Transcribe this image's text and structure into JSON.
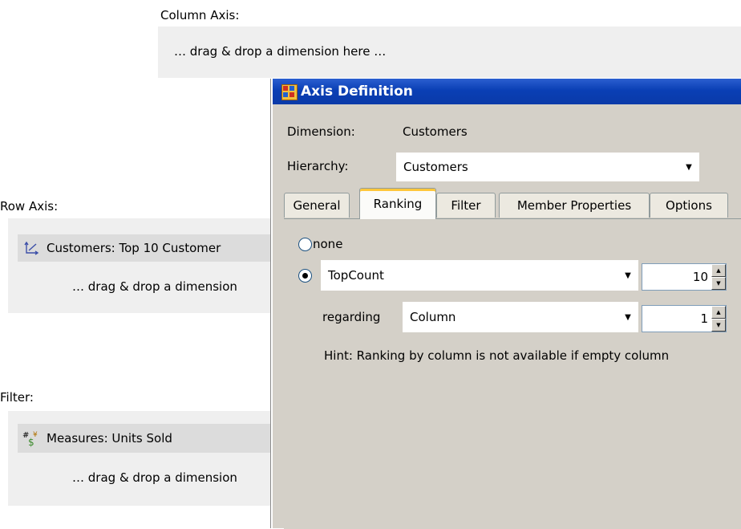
{
  "column_axis": {
    "label": "Column Axis:",
    "drop_hint": "… drag & drop a dimension here …"
  },
  "row_axis": {
    "label": "Row Axis:",
    "member": "Customers: Top 10 Customer",
    "member_icon": "axis-icon",
    "drop_hint": "… drag & drop a dimension"
  },
  "filter": {
    "label": "Filter:",
    "member": "Measures: Units Sold",
    "member_icon": "measures-icon",
    "drop_hint": "… drag & drop a dimension"
  },
  "dialog": {
    "title": "Axis Definition",
    "dimension_label": "Dimension:",
    "dimension_value": "Customers",
    "hierarchy_label": "Hierarchy:",
    "hierarchy_value": "Customers",
    "tabs": [
      {
        "label": "General",
        "active": false
      },
      {
        "label": "Ranking",
        "active": true
      },
      {
        "label": "Filter",
        "active": false
      },
      {
        "label": "Member Properties",
        "active": false
      },
      {
        "label": "Options",
        "active": false
      }
    ],
    "ranking": {
      "none_label": "none",
      "selected": "TopCount",
      "topcount_value": "TopCount",
      "count": "10",
      "regarding_label": "regarding",
      "regarding_value": "Column",
      "regarding_index": "1",
      "hint": "Hint: Ranking by column is not available if empty column"
    },
    "colors": {
      "title_bar": "#0a3fb5",
      "dialog_bg": "#d4d0c8",
      "active_tab_accent": "#ffc73c"
    }
  }
}
